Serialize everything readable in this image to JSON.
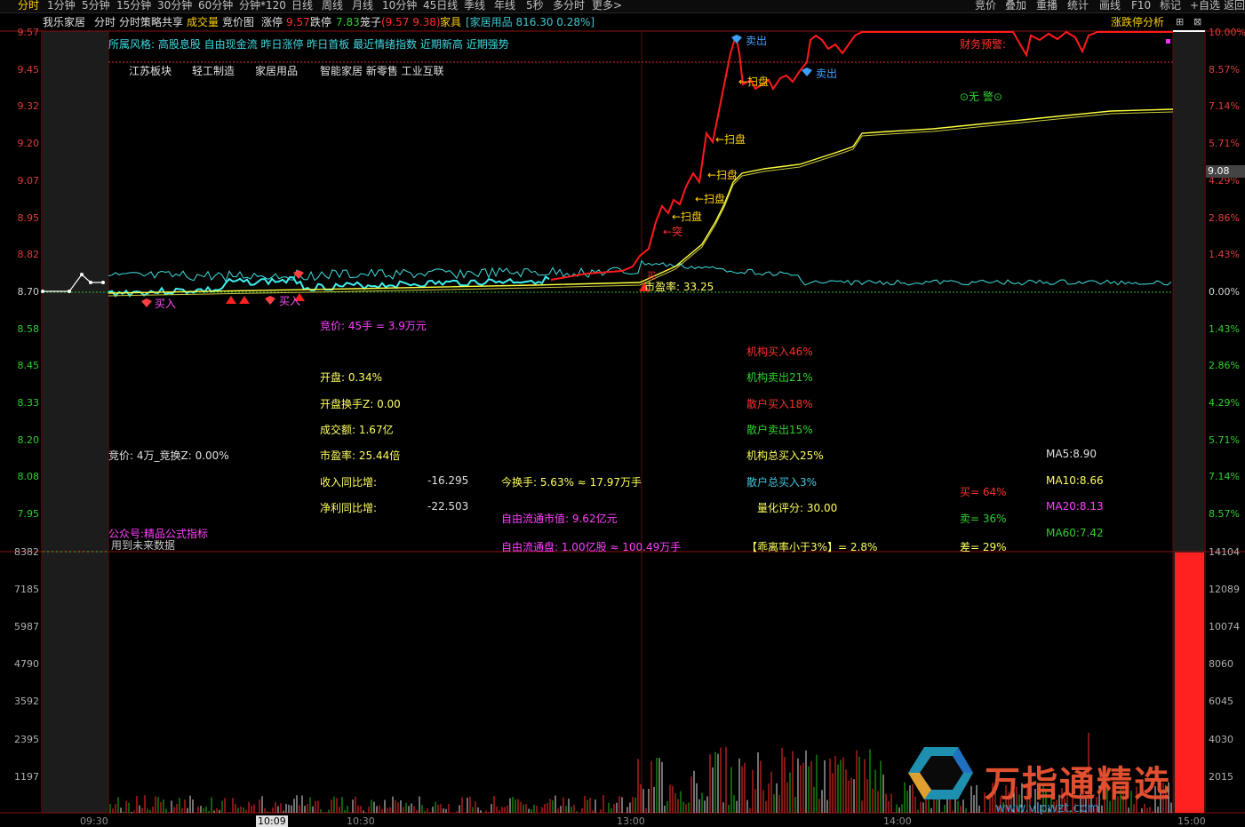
{
  "toolbar": {
    "tabs": [
      "分时",
      "1分钟",
      "5分钟",
      "15分钟",
      "30分钟",
      "60分钟",
      "分钟*120",
      "日线",
      "周线",
      "月线",
      "10分钟",
      "45日线",
      "季线",
      "年线",
      "5秒",
      "多分时",
      "更多"
    ],
    "right_tabs": [
      "竞价",
      "叠加",
      "重播",
      "统计",
      "画线",
      "F10",
      "标记",
      "+自选",
      "返回"
    ]
  },
  "header": {
    "stock_name": "我乐家居",
    "mode": "分时",
    "strategy": "分时策略共享",
    "volume_label": "成交量",
    "auction_chart": "竞价图",
    "limit_up_label": "涨停",
    "limit_up": "9.57",
    "limit_down_label": "跌停",
    "limit_down": "7.83",
    "cage_label": "笼子",
    "cage": "(9.57 9.38)",
    "sector": "家具",
    "index_info": "[家居用品 816.30 0.28%]",
    "analysis": "涨跌停分析"
  },
  "price_axis": {
    "left": [
      "9.57",
      "9.45",
      "9.32",
      "9.20",
      "9.07",
      "8.95",
      "8.82",
      "8.70",
      "8.58",
      "8.45",
      "8.33",
      "8.20",
      "8.08",
      "7.95"
    ],
    "right": [
      "10.00%",
      "8.57%",
      "7.14%",
      "5.71%",
      "4.29%",
      "2.86%",
      "1.43%",
      "0.00%",
      "1.43%",
      "2.86%",
      "4.29%",
      "5.71%",
      "7.14%",
      "8.57%"
    ],
    "cursor_price": "9.08"
  },
  "volume_axis": {
    "left": [
      "8382",
      "7185",
      "5987",
      "4790",
      "3592",
      "2395",
      "1197"
    ],
    "right": [
      "14104",
      "12089",
      "10074",
      "8060",
      "6045",
      "4030",
      "2015"
    ]
  },
  "time_axis": [
    "09:30",
    "10:09",
    "10:30",
    "13:00",
    "14:00",
    "15:00"
  ],
  "style_tags": "所属风格: 高股息股 自由现金流 昨日涨停 昨日首板 最近情绪指数 近期新高 近期强势",
  "concepts": [
    "江苏板块",
    "轻工制造",
    "家居用品",
    "智能家居 新零售 工业互联"
  ],
  "finance_warning": "财务预警:",
  "no_warning": "⊙无 警⊙",
  "signals": {
    "sell1": "卖出",
    "sell2": "卖出",
    "sweep1": "←扫盘",
    "sweep2": "←扫盘",
    "sweep3": "←扫盘",
    "sweep4": "←扫盘",
    "sweep5": "←扫盘",
    "breakout": "←突",
    "buy1": "买入",
    "buy2": "买入",
    "pe_mark": "市盈率: 33.25",
    "strong": "买"
  },
  "stats": {
    "auction_val": "竞价: 45手 = 3.9万元",
    "open_pct": "开盘: 0.34%",
    "open_turnover": "开盘换手Z: 0.00",
    "amount": "成交额: 1.67亿",
    "pe": "市盈率: 25.44倍",
    "rev_label": "收入同比增:",
    "rev_val": "-16.295",
    "profit_label": "净利同比增:",
    "profit_val": "-22.503",
    "turnover": "今换手: 5.63% ≈ 17.97万手",
    "float_mv": "自由流通市值: 9.62亿元",
    "float_shares": "自由流通盘: 1.00亿股 ≈ 100.49万手",
    "auction_left": "竞价: 4万_竞换Z: 0.00%",
    "inst_buy": "机构买入46%",
    "inst_sell": "机构卖出21%",
    "retail_buy": "散户买入18%",
    "retail_sell": "散户卖出15%",
    "inst_total": "机构总买入25%",
    "retail_total": "散户总买入3%",
    "quant": "量化评分: 30.00",
    "deviation": "【乖离率小于3%】= 2.8%",
    "buy_pct": "买= 64%",
    "sell_pct": "卖= 36%",
    "diff_pct": "差= 29%",
    "ma5": "MA5:8.90",
    "ma10": "MA10:8.66",
    "ma20": "MA20:8.13",
    "ma60": "MA60:7.42",
    "public": "公众号:精品公式指标",
    "future": "用到未来数据"
  },
  "watermark": {
    "title": "万指通精选",
    "url": "www.vipwzt.com"
  },
  "colors": {
    "price_line": "#ff1a1a",
    "avg_line": "#ffff40",
    "cyan_line": "#40e0e0",
    "up": "#ff3030",
    "down": "#20c020"
  }
}
